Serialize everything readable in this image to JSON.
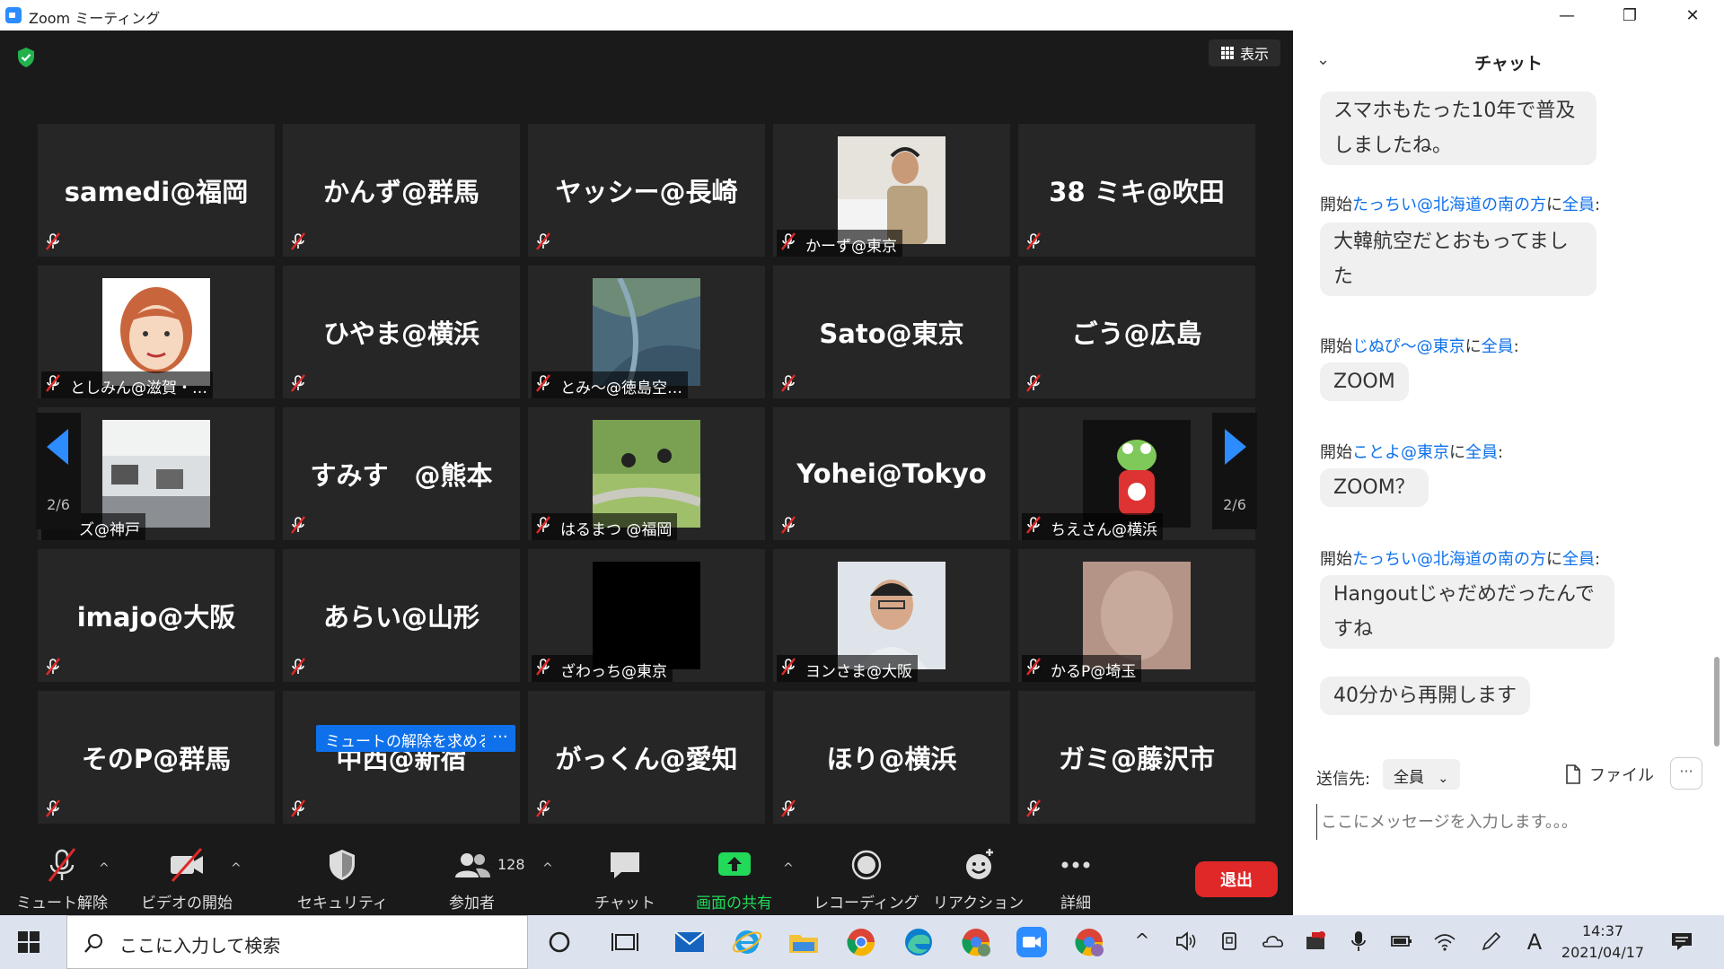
{
  "window": {
    "title": "Zoom ミーティング",
    "minimize": "—",
    "restore": "❐",
    "close": "✕"
  },
  "meeting": {
    "view_label": "表示",
    "page_left": "2/6",
    "page_right": "2/6",
    "unmute_request": "ミュートの解除を求める",
    "unmute_more": "···",
    "tiles": [
      {
        "name": "samedi@福岡"
      },
      {
        "name": "かんず@群馬"
      },
      {
        "name": "ヤッシー@長崎"
      },
      {
        "label": "かーず@東京"
      },
      {
        "name": "38 ミキ@吹田"
      },
      {
        "label": "としみん@滋賀・…"
      },
      {
        "name": "ひやま@横浜"
      },
      {
        "label": "とみ～@徳島空…"
      },
      {
        "name": "Sato@東京"
      },
      {
        "name": "ごう@広島"
      },
      {
        "label": "ズ@神戸"
      },
      {
        "name": "すみす　@熊本"
      },
      {
        "label": "はるまつ @福岡"
      },
      {
        "name": "Yohei@Tokyo"
      },
      {
        "label": "ちえさん@横浜"
      },
      {
        "name": "imajo@大阪"
      },
      {
        "name": "あらい@山形"
      },
      {
        "label": "ざわっち@東京"
      },
      {
        "label": "ヨンさま@大阪"
      },
      {
        "label": "かるP@埼玉"
      },
      {
        "name": "そのP@群馬"
      },
      {
        "name": "中西@新宿"
      },
      {
        "name": "がっくん@愛知"
      },
      {
        "name": "ほり@横浜"
      },
      {
        "name": "ガミ@藤沢市"
      }
    ]
  },
  "toolbar": {
    "mute": "ミュート解除",
    "video": "ビデオの開始",
    "security": "セキュリティ",
    "participants": "参加者",
    "participants_count": "128",
    "chat": "チャット",
    "share": "画面の共有",
    "record": "レコーディング",
    "reaction": "リアクション",
    "more": "詳細",
    "leave": "退出"
  },
  "chat": {
    "title": "チャット",
    "bubble_0": "スマホもたった10年で普及しましたね。",
    "sender_1_prefix": "開始",
    "sender_1_name": "たっちい@北海道の南の方",
    "sender_1_mid": "に",
    "sender_1_to": "全員",
    "sender_1_suffix": ":",
    "bubble_1": "大韓航空だとおもってました",
    "sender_2_prefix": "開始",
    "sender_2_name": "じぬぴ～@東京",
    "sender_2_mid": "に",
    "sender_2_to": "全員",
    "sender_2_suffix": ":",
    "bubble_2": "ZOOM",
    "sender_3_prefix": "開始",
    "sender_3_name": "ことよ@東京",
    "sender_3_mid": "に",
    "sender_3_to": "全員",
    "sender_3_suffix": ":",
    "bubble_3": "ZOOM？",
    "sender_4_prefix": "開始",
    "sender_4_name": "たっちい@北海道の南の方",
    "sender_4_mid": "に",
    "sender_4_to": "全員",
    "sender_4_suffix": ":",
    "bubble_4": "Hangoutじゃだめだったんですね",
    "bubble_5": "40分から再開します",
    "send_to_label": "送信先:",
    "send_to_value": "全員",
    "file_label": "ファイル",
    "more_label": "···",
    "input_placeholder": "ここにメッセージを入力します。。。"
  },
  "taskbar": {
    "search_placeholder": "ここに入力して検索",
    "time": "14:37",
    "date": "2021/04/17",
    "ime": "A"
  },
  "colors": {
    "meeting_bg": "#1a1a1a",
    "tile_bg": "#262626",
    "accent_blue": "#0e71eb",
    "share_green": "#23d959",
    "leave_red": "#e02828",
    "mic_red": "#e02828"
  }
}
